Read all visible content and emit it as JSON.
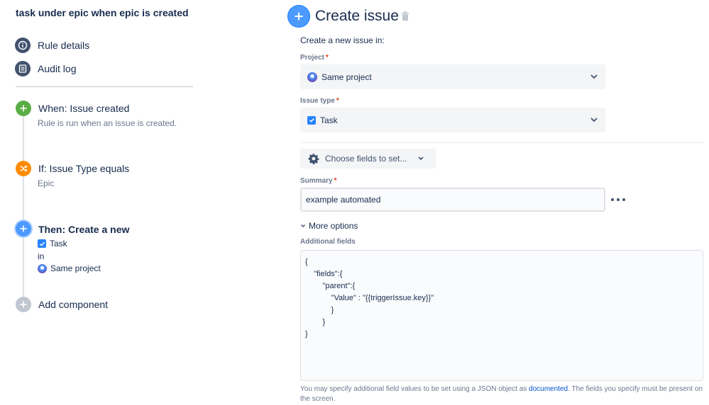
{
  "rule": {
    "title": "task under epic when epic is created"
  },
  "nav": [
    {
      "label": "Rule details",
      "icon": "info-icon"
    },
    {
      "label": "Audit log",
      "icon": "list-icon"
    }
  ],
  "steps": {
    "trigger": {
      "title": "When: Issue created",
      "subtitle": "Rule is run when an issue is created.",
      "icon": "plus-icon",
      "color": "#5aac44"
    },
    "condition": {
      "title": "If: Issue Type equals",
      "subtitle": "Epic",
      "icon": "shuffle-icon",
      "color": "#ff8b00"
    },
    "action": {
      "title": "Then: Create a new",
      "issue_type": "Task",
      "connector": "in",
      "project": "Same project",
      "icon": "plus-icon",
      "color": "#4c9aff"
    },
    "add": {
      "label": "Add component",
      "icon": "plus-icon",
      "color": "#c1c7d0"
    }
  },
  "editor": {
    "title": "Create issue",
    "subtitle": "Create a new issue in:",
    "project_label": "Project",
    "project_value": "Same project",
    "issue_type_label": "Issue type",
    "issue_type_value": "Task",
    "required_mark": "*",
    "choose_fields_label": "Choose fields to set...",
    "summary_label": "Summary",
    "summary_value": "example automated",
    "more_options_label": "More options",
    "additional_fields_label": "Additional fields",
    "additional_fields_value": "{\n    \"fields\":{\n        \"parent\":{\n            \"Value\" : \"{{triggerIssue.key}}\"\n            }\n        }\n}",
    "help_before": "You may specify additional field values to be set using a JSON object as ",
    "help_link": "documented",
    "help_after": ". The fields you specify must be present on the screen."
  },
  "colors": {
    "accent": "#4c9aff",
    "link": "#0052cc",
    "required": "#de350b"
  }
}
